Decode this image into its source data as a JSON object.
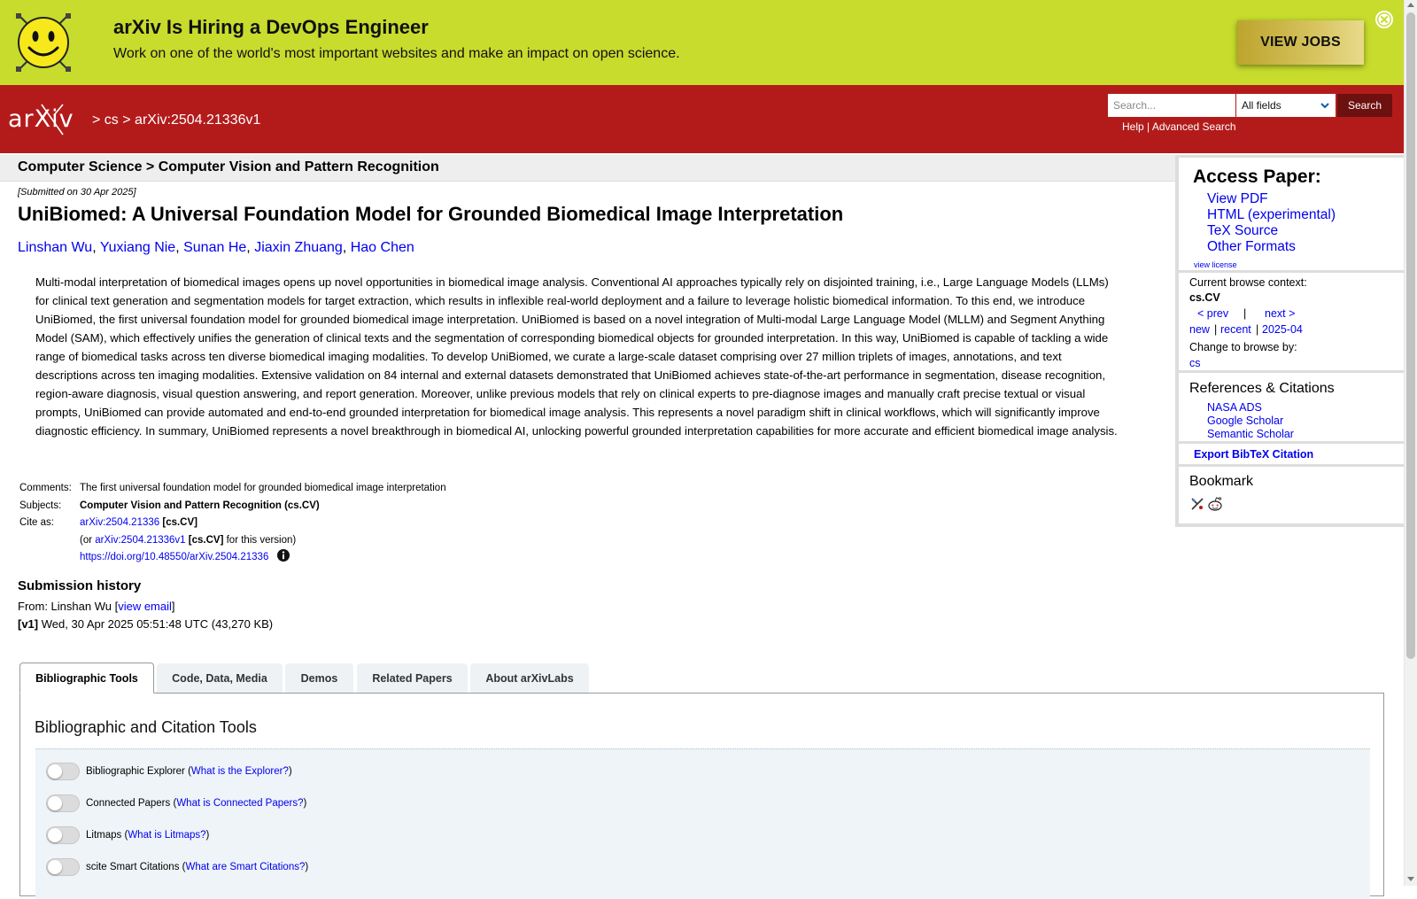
{
  "banner": {
    "title": "arXiv Is Hiring a DevOps Engineer",
    "subtitle": "Work on one of the world's most important websites and make an impact on open science.",
    "button_label": "VIEW JOBS"
  },
  "header": {
    "logo_text": "arXiv",
    "crumb_sep1": ">",
    "crumb_cs": "cs",
    "crumb_sep2": ">",
    "crumb_id": "arXiv:2504.21336v1",
    "search_placeholder": "Search...",
    "search_field": "All fields",
    "search_button": "Search",
    "help_link": "Help",
    "link_sep": "|",
    "advanced_link": "Advanced Search"
  },
  "category_bar": "Computer Science > Computer Vision and Pattern Recognition",
  "paper": {
    "submitted": "[Submitted on 30 Apr 2025]",
    "title": "UniBiomed: A Universal Foundation Model for Grounded Biomedical Image Interpretation",
    "authors": [
      "Linshan Wu",
      "Yuxiang Nie",
      "Sunan He",
      "Jiaxin Zhuang",
      "Hao Chen"
    ],
    "author_sep": ",",
    "abstract": "Multi-modal interpretation of biomedical images opens up novel opportunities in biomedical image analysis. Conventional AI approaches typically rely on disjointed training, i.e., Large Language Models (LLMs) for clinical text generation and segmentation models for target extraction, which results in inflexible real-world deployment and a failure to leverage holistic biomedical information. To this end, we introduce UniBiomed, the first universal foundation model for grounded biomedical image interpretation. UniBiomed is based on a novel integration of Multi-modal Large Language Model (MLLM) and Segment Anything Model (SAM), which effectively unifies the generation of clinical texts and the segmentation of corresponding biomedical objects for grounded interpretation. In this way, UniBiomed is capable of tackling a wide range of biomedical tasks across ten diverse biomedical imaging modalities. To develop UniBiomed, we curate a large-scale dataset comprising over 27 million triplets of images, annotations, and text descriptions across ten imaging modalities. Extensive validation on 84 internal and external datasets demonstrated that UniBiomed achieves state-of-the-art performance in segmentation, disease recognition, region-aware diagnosis, visual question answering, and report generation. Moreover, unlike previous models that rely on clinical experts to pre-diagnose images and manually craft precise textual or visual prompts, UniBiomed can provide automated and end-to-end grounded interpretation for biomedical image analysis. This represents a novel paradigm shift in clinical workflows, which will significantly improve diagnostic efficiency. In summary, UniBiomed represents a novel breakthrough in biomedical AI, unlocking powerful grounded interpretation capabilities for more accurate and efficient biomedical image analysis.",
    "comments_label": "Comments:",
    "comments": "The first universal foundation model for grounded biomedical image interpretation",
    "subjects_label": "Subjects:",
    "subjects": "Computer Vision and Pattern Recognition (cs.CV)",
    "cite_label": "Cite as:",
    "cite_id": "arXiv:2504.21336",
    "cite_tag": "[cs.CV]",
    "cite_or": "(or",
    "cite_version_id": "arXiv:2504.21336v1",
    "cite_version_tag": "[cs.CV]",
    "cite_version_suffix": "for this version)",
    "doi": "https://doi.org/10.48550/arXiv.2504.21336"
  },
  "history": {
    "title": "Submission history",
    "from_prefix": "From: Linshan Wu [",
    "view_email": "view email",
    "from_suffix": "]",
    "v1_label": "[v1]",
    "v1_text": "Wed, 30 Apr 2025 05:51:48 UTC (43,270 KB)"
  },
  "tabs": [
    {
      "label": "Bibliographic Tools"
    },
    {
      "label": "Code, Data, Media"
    },
    {
      "label": "Demos"
    },
    {
      "label": "Related Papers"
    },
    {
      "label": "About arXivLabs"
    }
  ],
  "tools_panel": {
    "title": "Bibliographic and Citation Tools",
    "open_paren": "(",
    "close_paren": ")",
    "tools": [
      {
        "name": "Bibliographic Explorer",
        "link": "What is the Explorer?"
      },
      {
        "name": "Connected Papers",
        "link": "What is Connected Papers?"
      },
      {
        "name": "Litmaps",
        "link": "What is Litmaps?"
      },
      {
        "name": "scite Smart Citations",
        "link": "What are Smart Citations?"
      }
    ]
  },
  "sidebar": {
    "access_title": "Access Paper:",
    "access_links": [
      "View PDF",
      "HTML (experimental)",
      "TeX Source",
      "Other Formats"
    ],
    "view_license": "view license",
    "browse_context_label": "Current browse context:",
    "browse_context": "cs.CV",
    "prev": "< prev",
    "pipe": "|",
    "next": "next >",
    "new": "new",
    "recent": "recent",
    "month": "2025-04",
    "change_browse": "Change to browse by:",
    "browse_cs": "cs",
    "refs_title": "References & Citations",
    "refs": [
      "NASA ADS",
      "Google Scholar",
      "Semantic Scholar"
    ],
    "export_bibtex": "Export BibTeX Citation",
    "bookmark_title": "Bookmark"
  },
  "colors": {
    "banner_bg": "#c7dc2d",
    "header_red": "#b31b1b",
    "link_blue": "#0000ee",
    "search_button": "#6d1010"
  }
}
